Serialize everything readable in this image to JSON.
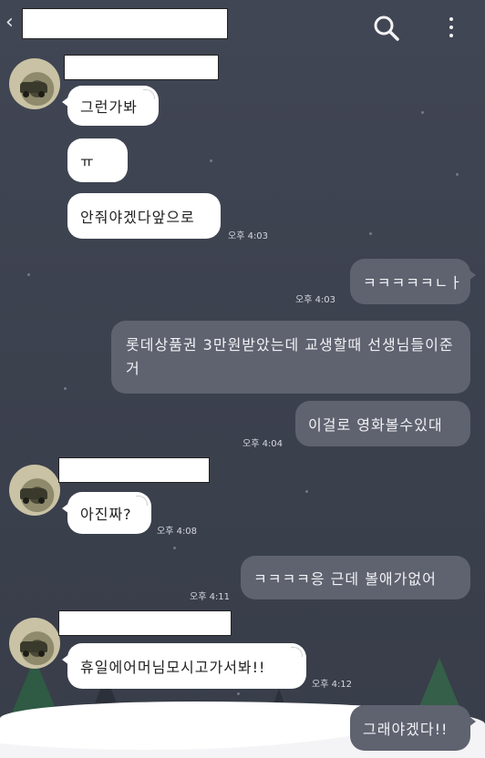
{
  "header": {
    "back_glyph": "‹",
    "search_icon": "search-icon",
    "more_icon": "more-vertical-icon"
  },
  "messages": [
    {
      "text": "그런가봐"
    },
    {
      "text": "ㅠ"
    },
    {
      "text": "안줘야겠다앞으로",
      "time": "오후 4:03"
    },
    {
      "text": "ㅋㅋㅋㅋㅋㄴㅏ",
      "time": "오후 4:03"
    },
    {
      "text": "롯데상품권 3만원받았는데 교생할때 선생님들이준거"
    },
    {
      "text": "이걸로 영화볼수있대",
      "time": "오후 4:04"
    },
    {
      "text": "아진짜?",
      "time": "오후 4:08"
    },
    {
      "text": "ㅋㅋㅋㅋ응 근데 볼애가없어",
      "time": "오후 4:11"
    },
    {
      "text": "휴일에어머님모시고가서봐!!",
      "time": "오후 4:12"
    },
    {
      "text": "그래야겠다!!"
    }
  ],
  "colors": {
    "background": "#3f4452",
    "incoming_bubble": "#ffffff",
    "outgoing_bubble": "#5f6370"
  }
}
